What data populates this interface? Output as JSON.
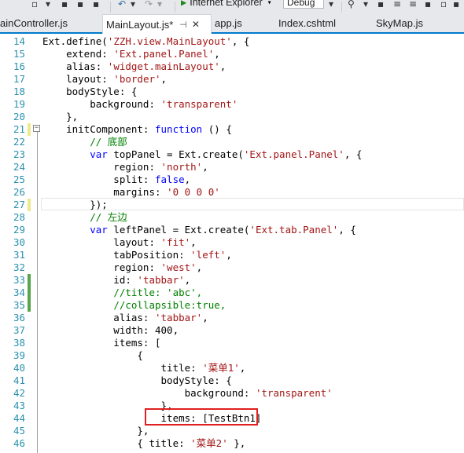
{
  "toolbar": {
    "browser_label": "Internet Explorer",
    "config_value": "Debug"
  },
  "tabs": [
    {
      "label": "ainController.js"
    },
    {
      "label": "MainLayout.js*",
      "active": true
    },
    {
      "label": "app.js"
    },
    {
      "label": "Index.cshtml"
    },
    {
      "label": "SkyMap.js"
    }
  ],
  "editor": {
    "lines": [
      {
        "n": "14",
        "text": "Ext.define('ZZH.view.MainLayout', {"
      },
      {
        "n": "15",
        "text": "    extend: 'Ext.panel.Panel',"
      },
      {
        "n": "16",
        "text": "    alias: 'widget.mainLayout',"
      },
      {
        "n": "17",
        "text": "    layout: 'border',"
      },
      {
        "n": "18",
        "text": "    bodyStyle: {"
      },
      {
        "n": "19",
        "text": "        background: 'transparent'"
      },
      {
        "n": "20",
        "text": "    },"
      },
      {
        "n": "21",
        "text": "    initComponent: function () {",
        "marker": "yellow"
      },
      {
        "n": "22",
        "text": "        // 底部"
      },
      {
        "n": "23",
        "text": "        var topPanel = Ext.create('Ext.panel.Panel', {"
      },
      {
        "n": "24",
        "text": "            region: 'north',"
      },
      {
        "n": "25",
        "text": "            split: false,"
      },
      {
        "n": "26",
        "text": "            margins: '0 0 0 0'"
      },
      {
        "n": "27",
        "text": "        });",
        "marker": "yellow"
      },
      {
        "n": "28",
        "text": "        // 左边"
      },
      {
        "n": "29",
        "text": "        var leftPanel = Ext.create('Ext.tab.Panel', {"
      },
      {
        "n": "30",
        "text": "            layout: 'fit',"
      },
      {
        "n": "31",
        "text": "            tabPosition: 'left',"
      },
      {
        "n": "32",
        "text": "            region: 'west',"
      },
      {
        "n": "33",
        "text": "            id: 'tabbar',",
        "marker": "green"
      },
      {
        "n": "34",
        "text": "            //title: 'abc',",
        "marker": "green"
      },
      {
        "n": "35",
        "text": "            //collapsible:true,",
        "marker": "green"
      },
      {
        "n": "36",
        "text": "            alias: 'tabbar',"
      },
      {
        "n": "37",
        "text": "            width: 400,"
      },
      {
        "n": "38",
        "text": "            items: ["
      },
      {
        "n": "39",
        "text": "                {"
      },
      {
        "n": "40",
        "text": "                    title: '菜单1',"
      },
      {
        "n": "41",
        "text": "                    bodyStyle: {"
      },
      {
        "n": "42",
        "text": "                        background: 'transparent'"
      },
      {
        "n": "43",
        "text": "                    },"
      },
      {
        "n": "44",
        "text": "                    items: [TestBtn1]"
      },
      {
        "n": "45",
        "text": "                },"
      },
      {
        "n": "46",
        "text": "                { title: '菜单2' },"
      }
    ]
  },
  "colors": {
    "keyword": "#0000ff",
    "string": "#a31515",
    "comment": "#008000",
    "line_number": "#2b91af",
    "highlight_border": "#e02020",
    "active_tab_accent": "#007acc"
  }
}
